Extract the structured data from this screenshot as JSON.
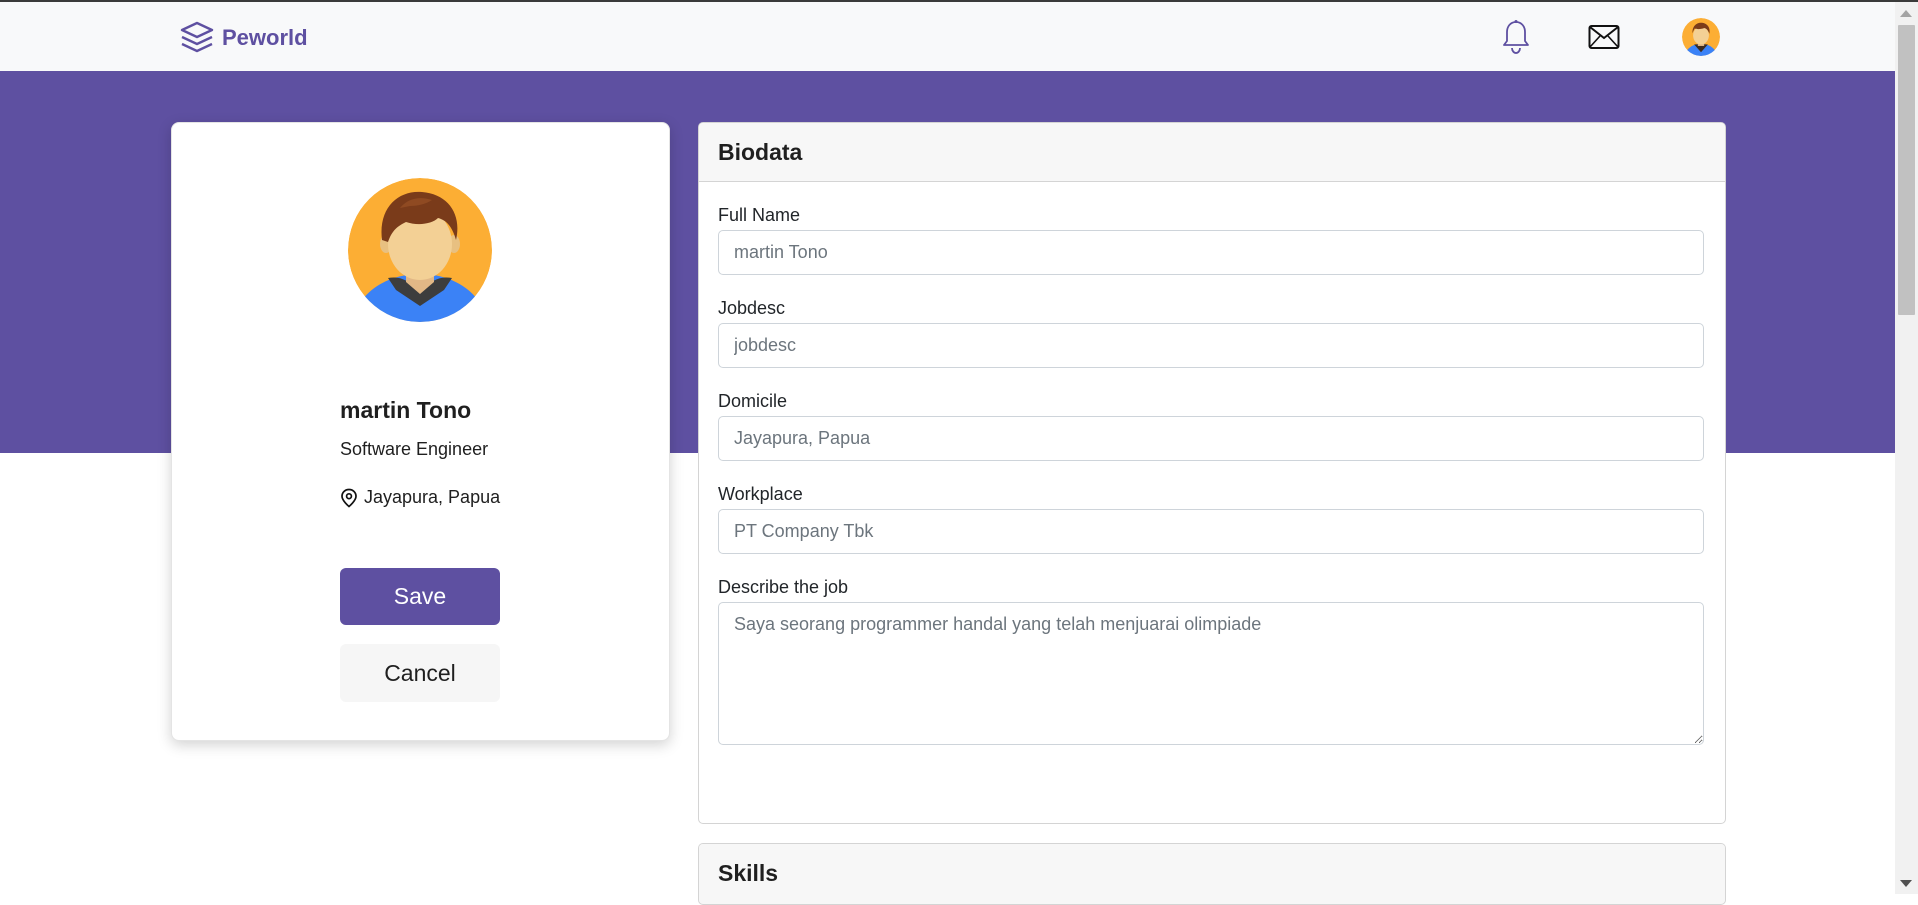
{
  "navbar": {
    "brand": "Peworld",
    "icons": [
      "layers-logo-icon",
      "bell-icon",
      "mail-icon",
      "user-avatar"
    ]
  },
  "profile": {
    "name": "martin Tono",
    "job": "Software Engineer",
    "location": "Jayapura, Papua",
    "save_label": "Save",
    "cancel_label": "Cancel"
  },
  "biodata": {
    "title": "Biodata",
    "fields": {
      "full_name": {
        "label": "Full Name",
        "placeholder": "martin Tono"
      },
      "jobdesc": {
        "label": "Jobdesc",
        "placeholder": "jobdesc"
      },
      "domicile": {
        "label": "Domicile",
        "placeholder": "Jayapura, Papua"
      },
      "workplace": {
        "label": "Workplace",
        "placeholder": "PT Company Tbk"
      },
      "describe": {
        "label": "Describe the job",
        "placeholder": "Saya seorang programmer handal yang telah menjuarai olimpiade"
      }
    }
  },
  "skills": {
    "title": "Skills"
  },
  "colors": {
    "brand": "#5e50a1",
    "navbar_bg": "#f8f9fa",
    "avatar_bg": "#fcae34",
    "shirt": "#3b82f6"
  }
}
